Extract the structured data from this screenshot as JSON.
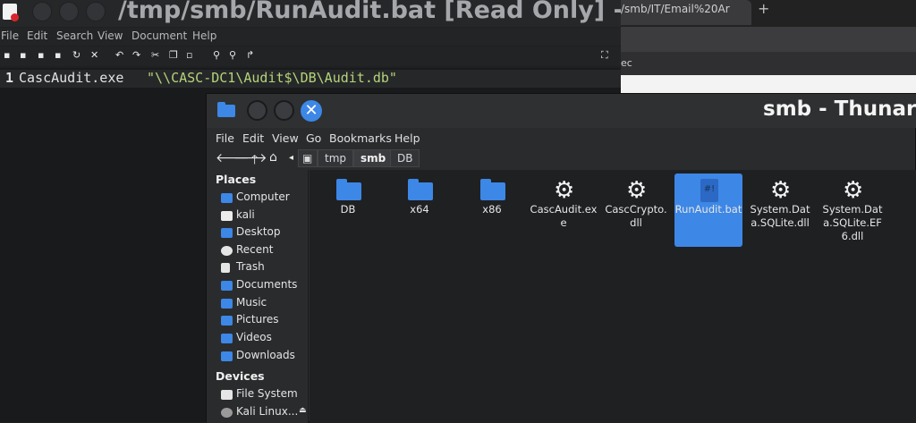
{
  "editor": {
    "title": "/tmp/smb/RunAudit.bat [Read Only] - Mo",
    "menu": [
      "File",
      "Edit",
      "Search",
      "View",
      "Document",
      "Help"
    ],
    "line_number": "1",
    "code_plain": "CascAudit.exe ",
    "code_string": "\"\\\\CASC-DC1\\Audit$\\DB\\Audit.db\""
  },
  "browser": {
    "tab_label": "/smb/IT/Email%20Ar",
    "newtab": "+",
    "bar2_label": "ec"
  },
  "thunar": {
    "title": "smb - Thunar",
    "close_glyph": "✕",
    "menu": [
      "File",
      "Edit",
      "View",
      "Go",
      "Bookmarks",
      "Help"
    ],
    "breadcrumbs": [
      "tmp",
      "smb",
      "DB"
    ],
    "places_heading": "Places",
    "places": [
      "Computer",
      "kali",
      "Desktop",
      "Recent",
      "Trash",
      "Documents",
      "Music",
      "Pictures",
      "Videos",
      "Downloads"
    ],
    "devices_heading": "Devices",
    "devices": [
      "File System",
      "Kali Linux..."
    ],
    "files": [
      {
        "name": "DB",
        "type": "folder"
      },
      {
        "name": "x64",
        "type": "folder"
      },
      {
        "name": "x86",
        "type": "folder"
      },
      {
        "name": "CascAudit.exe",
        "type": "exe"
      },
      {
        "name": "CascCrypto.dll",
        "type": "dll"
      },
      {
        "name": "RunAudit.bat",
        "type": "bat",
        "selected": true
      },
      {
        "name": "System.Data.SQLite.dll",
        "type": "dll"
      },
      {
        "name": "System.Data.SQLite.EF6.dll",
        "type": "dll"
      }
    ],
    "accent": "#3d87e6"
  }
}
